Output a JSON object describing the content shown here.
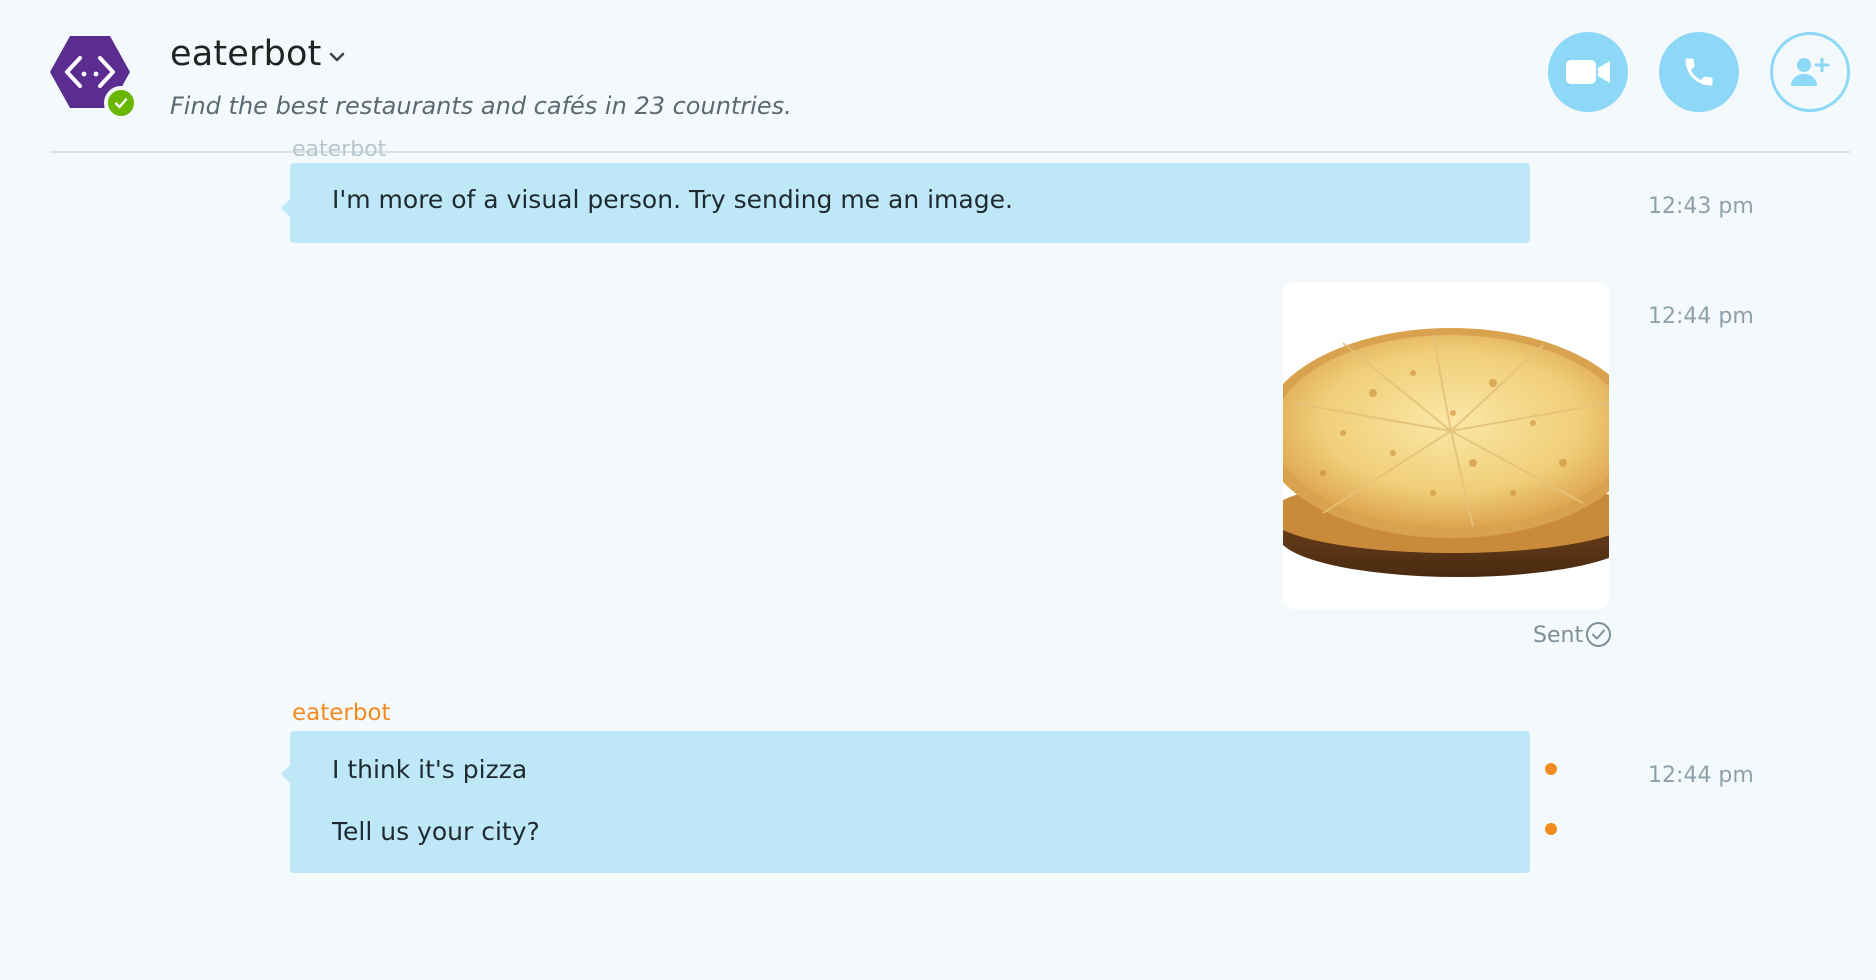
{
  "header": {
    "bot_name": "eaterbot",
    "description": "Find the best restaurants and cafés in 23 countries.",
    "avatar_icon": "bot-code-icon",
    "presence_icon": "online-check-icon",
    "actions": [
      {
        "name": "video-call",
        "icon": "video-camera-icon"
      },
      {
        "name": "audio-call",
        "icon": "phone-icon"
      },
      {
        "name": "add-contact",
        "icon": "add-person-icon"
      }
    ]
  },
  "colors": {
    "background": "#f4f9fc",
    "bubble": "#bee8f8",
    "accent": "#8dd7f7",
    "avatar": "#5c2d91",
    "presence": "#6bb700",
    "sender": "#f28b1f",
    "unread_dot": "#f28b1f"
  },
  "messages": [
    {
      "sender": "eaterbot",
      "text": "I'm more of a visual person. Try sending me an image.",
      "time": "12:43 pm"
    },
    {
      "sender": "me",
      "image": "pizza-photo",
      "time": "12:44 pm",
      "status": "Sent",
      "status_icon": "check-circle-icon"
    },
    {
      "sender": "eaterbot",
      "lines": [
        "I think it's pizza",
        "Tell us your city?"
      ],
      "time": "12:44 pm"
    }
  ]
}
